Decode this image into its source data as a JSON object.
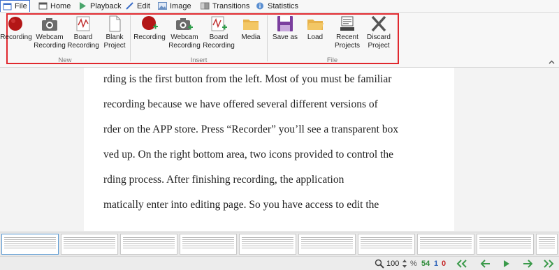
{
  "menu": {
    "tabs": [
      {
        "label": "File"
      },
      {
        "label": "Home"
      },
      {
        "label": "Playback"
      },
      {
        "label": "Edit"
      },
      {
        "label": "Image"
      },
      {
        "label": "Transitions"
      },
      {
        "label": "Statistics"
      }
    ]
  },
  "ribbon": {
    "groups": [
      {
        "label": "New",
        "buttons": [
          {
            "label": "Recording",
            "icon": "recording-icon"
          },
          {
            "label": "Webcam\nRecording",
            "icon": "webcam-icon"
          },
          {
            "label": "Board\nRecording",
            "icon": "board-icon"
          },
          {
            "label": "Blank\nProject",
            "icon": "blank-page-icon"
          }
        ]
      },
      {
        "label": "Insert",
        "buttons": [
          {
            "label": "Recording",
            "icon": "recording-add-icon"
          },
          {
            "label": "Webcam\nRecording",
            "icon": "webcam-add-icon"
          },
          {
            "label": "Board\nRecording",
            "icon": "board-add-icon"
          },
          {
            "label": "Media",
            "icon": "folder-icon"
          }
        ]
      },
      {
        "label": "File",
        "buttons": [
          {
            "label": "Save as",
            "icon": "save-icon"
          },
          {
            "label": "Load",
            "icon": "folder-open-icon"
          },
          {
            "label": "Recent\nProjects",
            "icon": "recent-projects-icon"
          },
          {
            "label": "Discard\nProject",
            "icon": "discard-icon"
          }
        ]
      }
    ],
    "highlight_color": "#e0282e"
  },
  "document": {
    "lines": [
      "rding is the first button from the left. Most of you must be familiar",
      "recording because we have offered several different versions of",
      "rder on the APP store. Press “Recorder” you’ll see a transparent box",
      "ved up. On the right bottom area, two icons provided to control the",
      "rding process. After finishing recording, the application",
      "matically enter into editing page. So you have access to edit the"
    ]
  },
  "status": {
    "zoom": "100",
    "percent_symbol": "%",
    "frame_total": "54",
    "frame_current": "1",
    "frame_selected": "0"
  }
}
